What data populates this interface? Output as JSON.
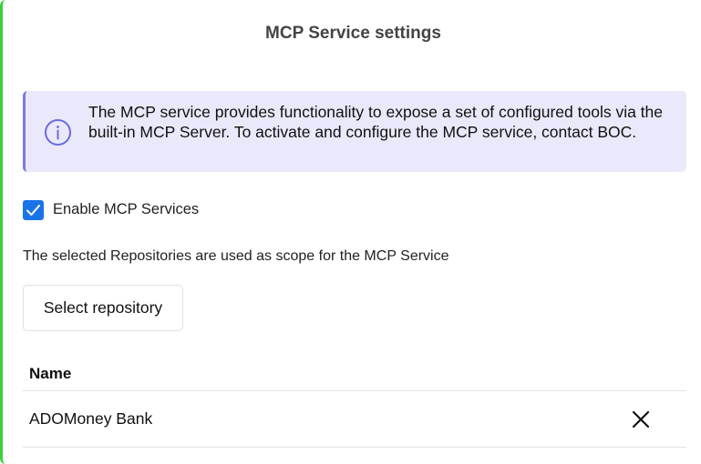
{
  "dialog": {
    "title": "MCP Service settings"
  },
  "info": {
    "text": "The MCP service provides functionality to expose a set of configured tools via the built-in MCP Server. To activate and configure the MCP service, contact BOC.",
    "icon": "info-icon",
    "accent": "#7a7ae6",
    "background": "#e9e9fb"
  },
  "enable": {
    "label": "Enable MCP Services",
    "checked": true,
    "color": "#1a73e8"
  },
  "scope": {
    "text": "The selected Repositories are used as scope for the MCP Service"
  },
  "select_button": {
    "label": "Select repository"
  },
  "table": {
    "columns": [
      "Name"
    ],
    "rows": [
      {
        "name": "ADOMoney Bank",
        "remove_icon": "close-icon"
      }
    ]
  },
  "colors": {
    "panel_accent": "#3ccf3c"
  }
}
